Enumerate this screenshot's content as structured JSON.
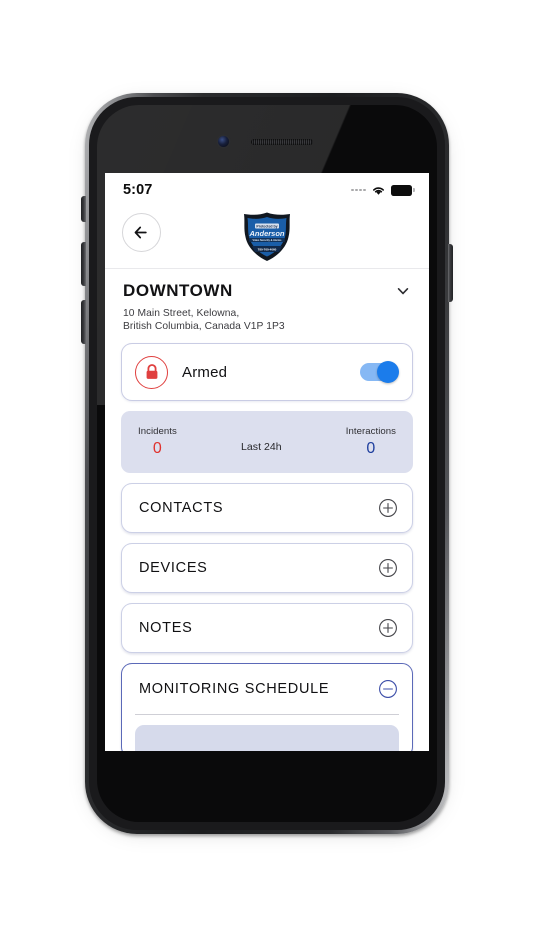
{
  "status_bar": {
    "time": "5:07",
    "signal_icon": "signal-dots-icon",
    "wifi_icon": "wifi-icon",
    "battery_icon": "battery-full-icon"
  },
  "appbar": {
    "back_icon": "arrow-left-icon",
    "logo": {
      "name": "anderson-shield-logo",
      "line1": "Protected by",
      "line2": "Anderson",
      "line3": "Video Security & Alarms",
      "line4": "780-760-4060",
      "color_outer": "#111821",
      "color_inner": "#1a5ea8"
    }
  },
  "site": {
    "name": "DOWNTOWN",
    "expand_icon": "chevron-down-icon",
    "address_line1": "10 Main Street, Kelowna,",
    "address_line2": "British Columbia, Canada V1P 1P3"
  },
  "armed_card": {
    "lock_icon": "lock-closed-icon",
    "label": "Armed",
    "toggle_state": "on",
    "accent_color": "#1b7ceb",
    "lock_color": "#e0403f"
  },
  "stats": {
    "incidents_label": "Incidents",
    "incidents_value": "0",
    "incidents_color": "#e0322e",
    "middle_label": "Last 24h",
    "interactions_label": "Interactions",
    "interactions_value": "0",
    "interactions_color": "#1f3f9e",
    "background_color": "#dcdfee"
  },
  "sections": [
    {
      "title": "CONTACTS",
      "action_icon": "plus-circle-icon",
      "expanded": false
    },
    {
      "title": "DEVICES",
      "action_icon": "plus-circle-icon",
      "expanded": false
    },
    {
      "title": "NOTES",
      "action_icon": "plus-circle-icon",
      "expanded": false
    },
    {
      "title": "MONITORING SCHEDULE",
      "action_icon": "minus-circle-icon",
      "expanded": true
    }
  ]
}
